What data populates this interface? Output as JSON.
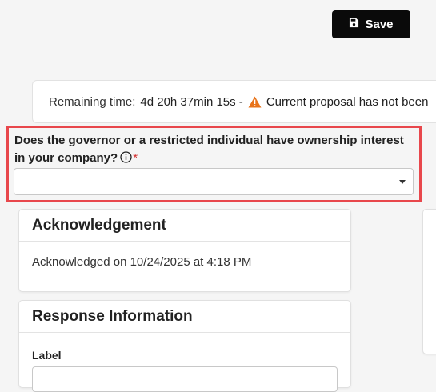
{
  "toolbar": {
    "save_label": "Save",
    "save_icon": "floppy-disk-icon"
  },
  "timer": {
    "label": "Remaining time:",
    "value": "4d 20h 37min 15s -",
    "warning_icon": "warning-triangle-icon",
    "warning_color": "#e8731a",
    "message": "Current proposal has not been"
  },
  "question": {
    "text": "Does the governor or a restricted individual have ownership interest in your company?",
    "required_mark": "*",
    "info_icon": "info-circle-icon",
    "selected_value": "",
    "highlight_color": "#e8474c"
  },
  "acknowledgement": {
    "title": "Acknowledgement",
    "text": "Acknowledged on 10/24/2025 at 4:18 PM"
  },
  "response_info": {
    "title": "Response Information",
    "label_field": "Label"
  }
}
